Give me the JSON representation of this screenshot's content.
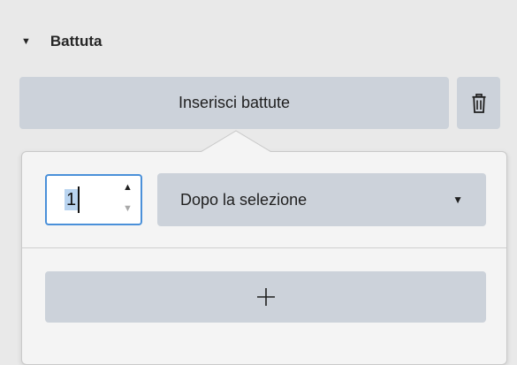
{
  "section": {
    "title": "Battuta",
    "expanded_icon": "triangle-down-icon"
  },
  "actions": {
    "insert_label": "Inserisci battute",
    "delete_icon": "trash-icon"
  },
  "popover": {
    "count_value": "1",
    "position_select": {
      "selected": "Dopo la selezione"
    },
    "add_icon": "plus-icon"
  },
  "colors": {
    "button_bg": "#ccd2da",
    "focus_border": "#4a90d9",
    "panel_bg": "#f4f4f4",
    "page_bg": "#e9e9e9"
  }
}
